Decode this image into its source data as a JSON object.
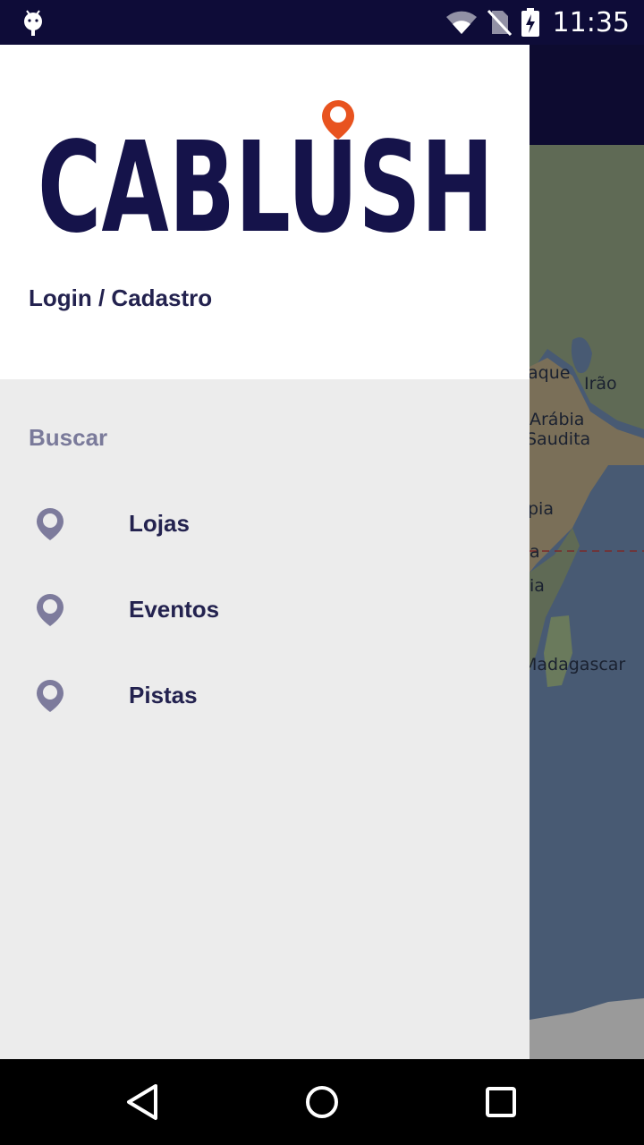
{
  "status_bar": {
    "time": "11:35"
  },
  "map": {
    "labels": [
      "aque",
      "Irão",
      "Arábia",
      "Saudita",
      "pia",
      "a",
      "ia",
      "Madagascar"
    ]
  },
  "drawer": {
    "brand": "CABLUSH",
    "login_label": "Login / Cadastro",
    "section_title": "Buscar",
    "items": [
      {
        "label": "Lojas",
        "icon": "map-pin-icon"
      },
      {
        "label": "Eventos",
        "icon": "map-pin-icon"
      },
      {
        "label": "Pistas",
        "icon": "map-pin-icon"
      }
    ]
  },
  "nav_bar": {
    "buttons": [
      "back-icon",
      "home-icon",
      "recents-icon"
    ]
  },
  "colors": {
    "brand_navy": "#15134a",
    "pin_orange": "#e8531f",
    "drawer_bg": "#ececec",
    "icon_gray": "#7d7b9c"
  }
}
